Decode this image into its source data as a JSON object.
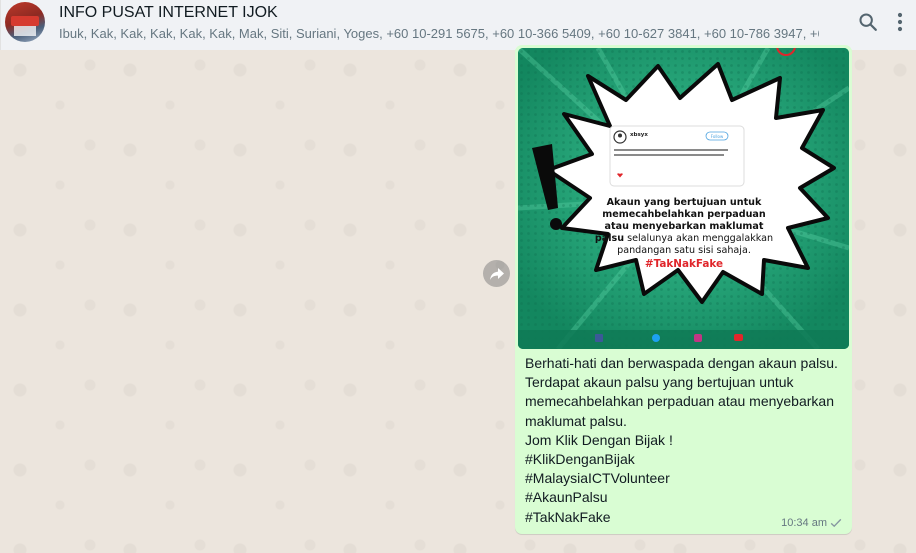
{
  "header": {
    "title": "INFO PUSAT INTERNET IJOK",
    "members": "Ibuk, Kak, Kak, Kak, Kak, Kak, Mak, Siti, Suriani, Yoges, +60 10-291 5675, +60 10-366 5409, +60 10-627 3841, +60 10-786 3947, +60 ..."
  },
  "message": {
    "image": {
      "card_user": "xbsyx",
      "card_follow": "Follow",
      "headline_line1": "Akaun yang bertujuan untuk",
      "headline_line2": "memecahbelahkan perpaduan",
      "headline_line3": "atau menyebarkan maklumat",
      "headline_line4_bold": "palsu",
      "headline_line4_rest": " selalunya akan menggalakkan",
      "headline_line5": "pandangan satu sisi sahaja.",
      "hashtag": "#TakNakFake"
    },
    "caption": "Berhati-hati dan berwaspada dengan akaun palsu.\nTerdapat akaun palsu yang bertujuan untuk memecahbelahkan perpaduan atau menyebarkan maklumat palsu.\nJom Klik Dengan Bijak !\n#KlikDenganBijak\n#MalaysiaICTVolunteer\n#AkaunPalsu\n#TakNakFake",
    "time": "10:34 am"
  },
  "colors": {
    "accent_green": "#1f9e73",
    "hashtag_red": "#e0262b",
    "bubble_bg": "#d9fdd3"
  }
}
